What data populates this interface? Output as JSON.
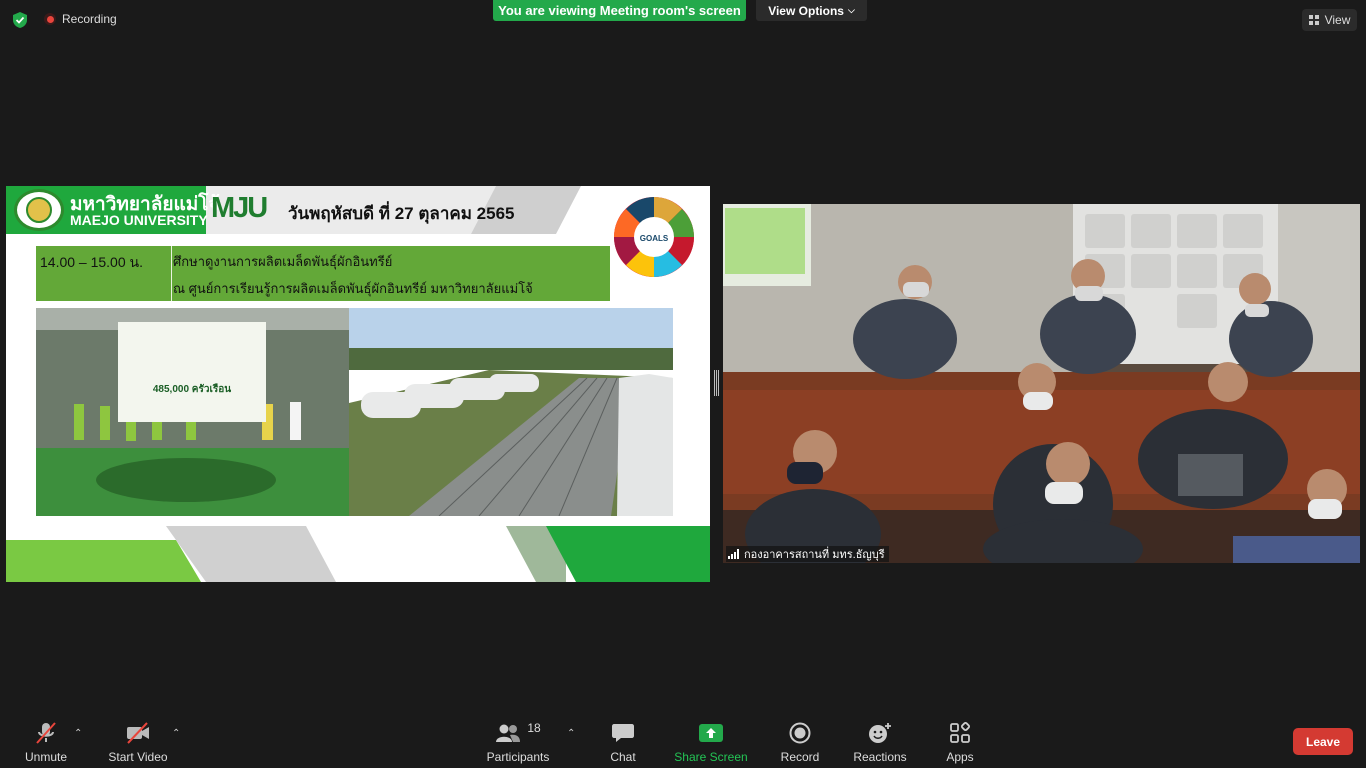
{
  "top_bar": {
    "recording_label": "Recording",
    "viewing_banner": "You are viewing Meeting room's screen",
    "view_options_label": "View Options",
    "view_label": "View"
  },
  "shared_slide": {
    "university_name_th": "มหาวิทยาลัยแม่โจ้",
    "university_name_en": "MAEJO UNIVERSITY",
    "mju_logo_text": "MJU",
    "date_text": "วันพฤหัสบดี ที่ 27 ตุลาคม 2565",
    "agenda_time": "14.00 – 15.00 น.",
    "agenda_line1": "ศึกษาดูงานการผลิตเมล็ดพันธุ์ผักอินทรีย์",
    "agenda_line2": "ณ ศูนย์การเรียนรู้การผลิตเมล็ดพันธุ์ผักอินทรีย์ มหาวิทยาลัยแม่โจ้",
    "banner_count": "485,000 ครัวเรือน",
    "sdg_text": "GOALS",
    "colors": {
      "green_dark": "#1fa83d",
      "green_light": "#7ac943",
      "agenda_bg": "#63a838"
    }
  },
  "camera_tile": {
    "participant_name": "กองอาคารสถานที่ มทร.ธัญบุรี"
  },
  "toolbar": {
    "unmute_label": "Unmute",
    "start_video_label": "Start Video",
    "participants_label": "Participants",
    "participants_count": "18",
    "chat_label": "Chat",
    "share_screen_label": "Share Screen",
    "record_label": "Record",
    "reactions_label": "Reactions",
    "apps_label": "Apps",
    "leave_label": "Leave",
    "colors": {
      "share_green": "#23a94b",
      "leave_red": "#d43a32"
    }
  }
}
